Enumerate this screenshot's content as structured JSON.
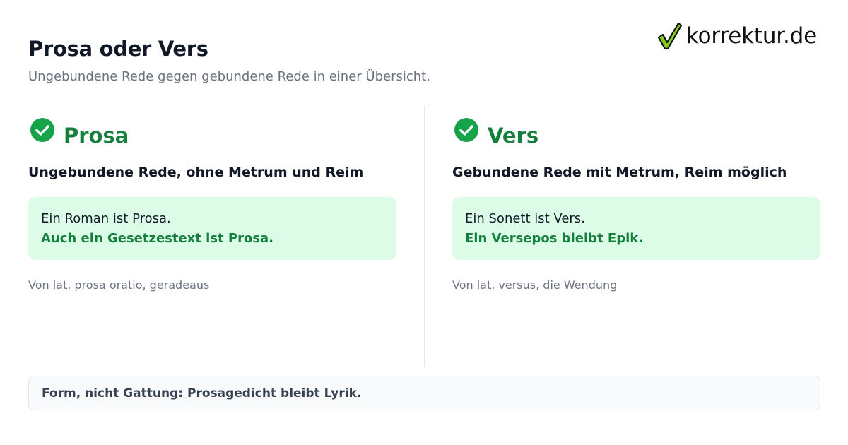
{
  "header": {
    "title": "Prosa oder Vers",
    "subtitle": "Ungebundene Rede gegen gebundene Rede in einer Übersicht."
  },
  "logo": {
    "text": "korrektur.de",
    "icon": "checkmark-icon",
    "accent": "#84cc16"
  },
  "columns": [
    {
      "icon": "check-circle-icon",
      "title": "Prosa",
      "definition": "Ungebundene Rede, ohne Metrum und Reim",
      "example_1": "Ein Roman ist Prosa.",
      "example_2": "Auch ein Gesetzestext ist Prosa.",
      "etymology": "Von lat. prosa oratio, geradeaus"
    },
    {
      "icon": "check-circle-icon",
      "title": "Vers",
      "definition": "Gebundene Rede mit Metrum, Reim möglich",
      "example_1": "Ein Sonett ist Vers.",
      "example_2": "Ein Versepos bleibt Epik.",
      "etymology": "Von lat. versus, die Wendung"
    }
  ],
  "note": "Form, nicht Gattung: Prosagedicht bleibt Lyrik.",
  "colors": {
    "green": "#15803d",
    "icon_green": "#16a34a",
    "box_bg": "#dcfce7",
    "text_dark": "#111827",
    "text_muted": "#6b7280"
  }
}
